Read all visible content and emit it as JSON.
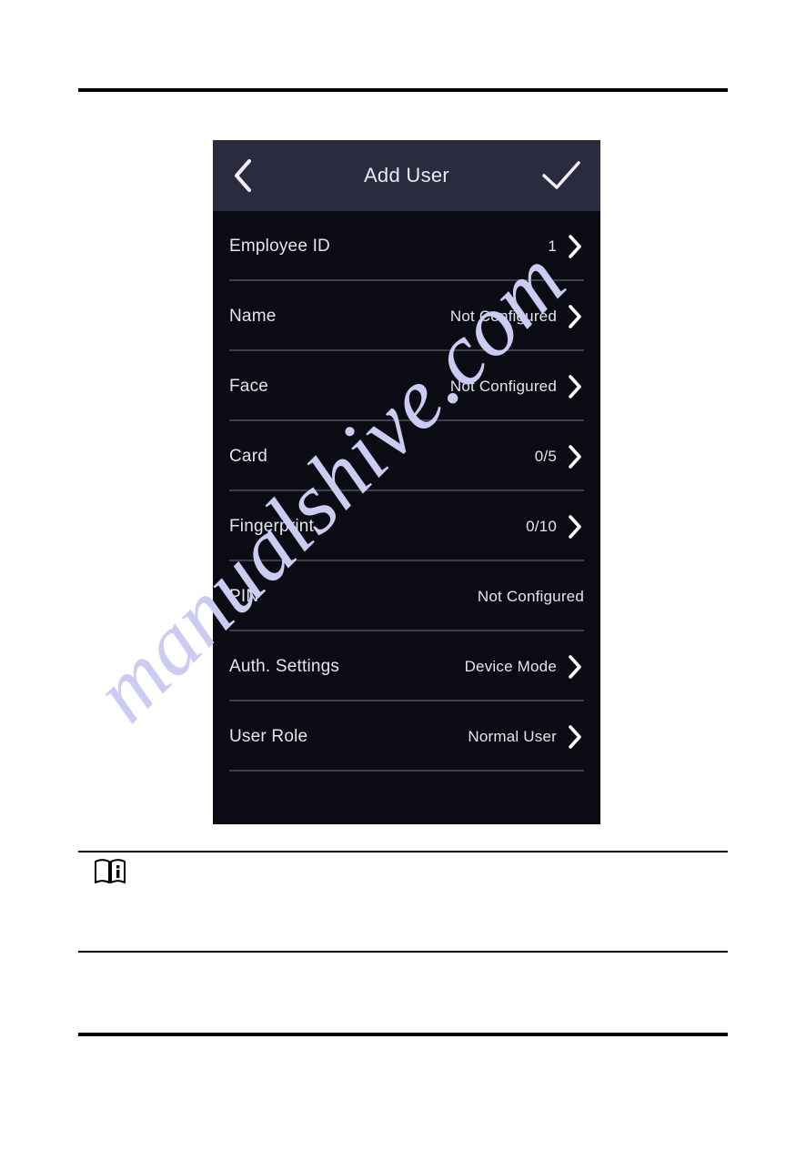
{
  "device": {
    "header": {
      "title": "Add User",
      "back_icon": "chevron-left-icon",
      "confirm_icon": "check-icon"
    },
    "rows": [
      {
        "label": "Employee ID",
        "value": "1",
        "chevron": true
      },
      {
        "label": "Name",
        "value": "Not Configured",
        "chevron": true
      },
      {
        "label": "Face",
        "value": "Not Configured",
        "chevron": true
      },
      {
        "label": "Card",
        "value": "0/5",
        "chevron": true
      },
      {
        "label": "Fingerprint",
        "value": "0/10",
        "chevron": true
      },
      {
        "label": "PIN",
        "value": "Not Configured",
        "chevron": false
      },
      {
        "label": "Auth. Settings",
        "value": "Device Mode",
        "chevron": true
      },
      {
        "label": "User Role",
        "value": "Normal User",
        "chevron": true
      }
    ]
  },
  "page": {
    "note_icon": "manual-info-book-icon",
    "watermark": "manualshive.com"
  },
  "colors": {
    "header_bar": "#2b2b3f",
    "panel_bg": "#0b0b14",
    "separator": "#3d3d4c",
    "text": "#e4e4ee",
    "watermark": "#ccccf2",
    "rule": "#000000"
  }
}
